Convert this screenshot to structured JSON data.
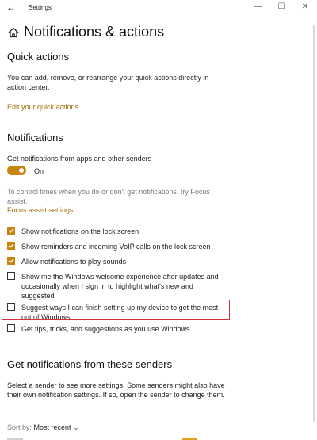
{
  "window": {
    "title": "Settings",
    "controls": {
      "minimize": "—",
      "maximize": "☐",
      "close": "✕"
    }
  },
  "page": {
    "title": "Notifications & actions"
  },
  "quick_actions": {
    "heading": "Quick actions",
    "description": "You can add, remove, or rearrange your quick actions directly in action center.",
    "edit_link": "Edit your quick actions"
  },
  "notifications": {
    "heading": "Notifications",
    "get_label": "Get notifications from apps and other senders",
    "toggle_state": "On",
    "focus_text": "To control times when you do or don't get notifications, try Focus assist.",
    "focus_link": "Focus assist settings",
    "options": [
      {
        "label": "Show notifications on the lock screen",
        "checked": true
      },
      {
        "label": "Show reminders and incoming VoIP calls on the lock screen",
        "checked": true
      },
      {
        "label": "Allow notifications to play sounds",
        "checked": true
      },
      {
        "label": "Show me the Windows welcome experience after updates and occasionally when I sign in to highlight what's new and suggested",
        "checked": false
      },
      {
        "label": "Suggest ways I can finish setting up my device to get the most out of Windows",
        "checked": false
      },
      {
        "label": "Get tips, tricks, and suggestions as you use Windows",
        "checked": false
      }
    ]
  },
  "senders": {
    "heading": "Get notifications from these senders",
    "description": "Select a sender to see more settings. Some senders might also have their own notification settings. If so, open the sender to change them.",
    "sort_label": "Sort by:",
    "sort_value": "Most recent"
  },
  "colors": {
    "accent": "#c8850d",
    "link": "#a46b00",
    "highlight": "#d0323b"
  }
}
